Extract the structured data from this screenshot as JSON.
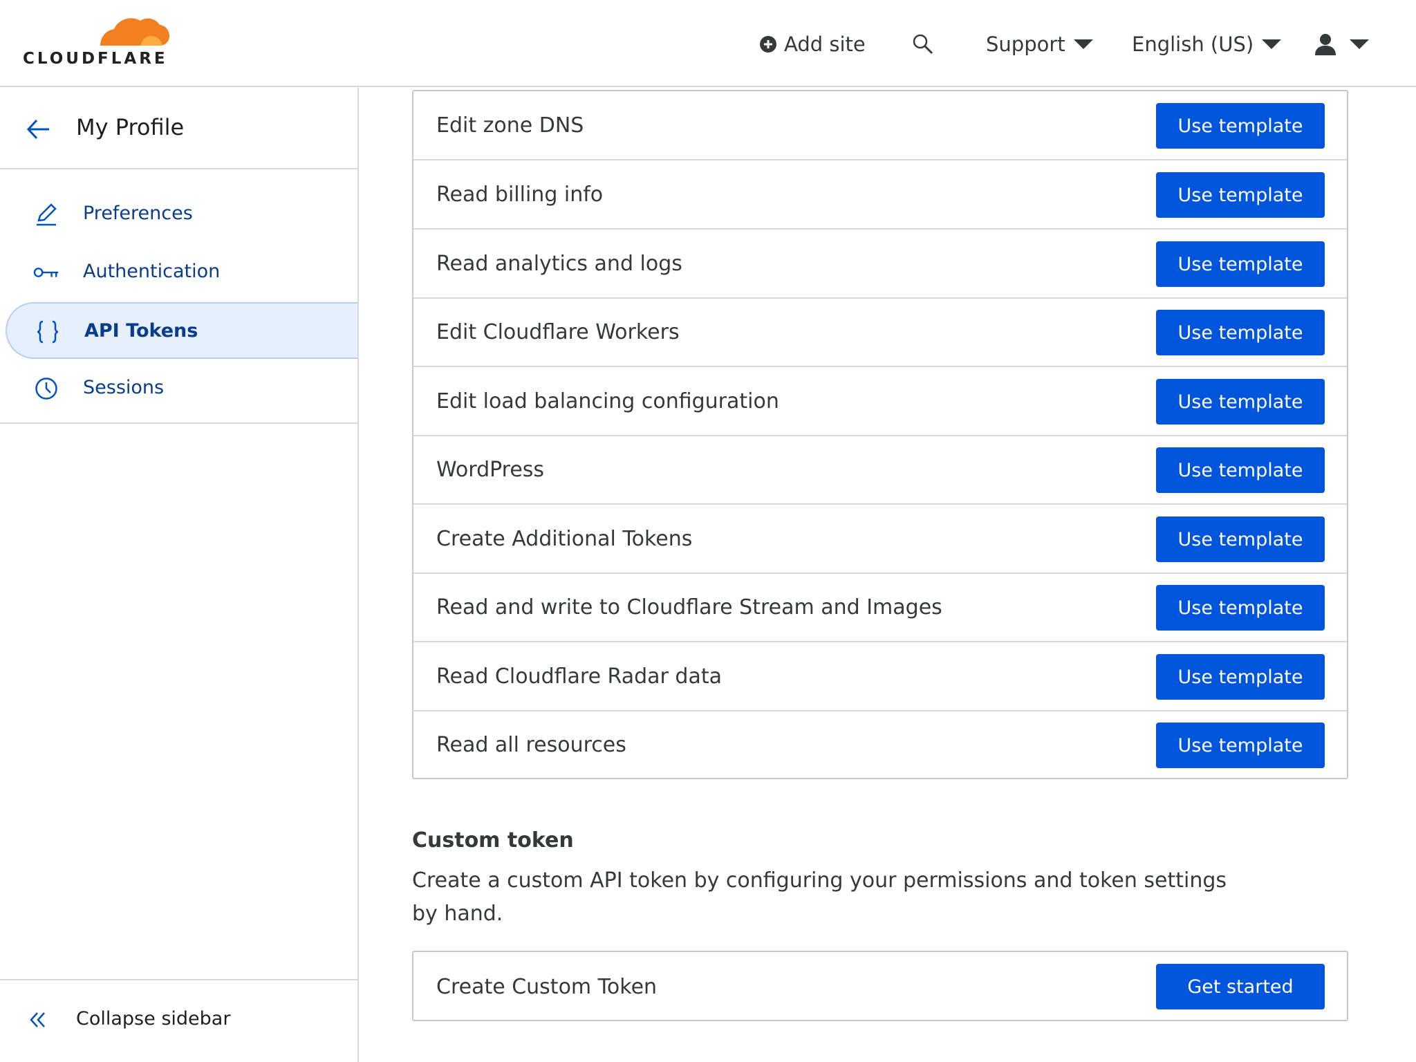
{
  "header": {
    "logo_text": "CLOUDFLARE",
    "add_site_label": "Add site",
    "support_label": "Support",
    "language_label": "English (US)",
    "icons": [
      "plus-circle-icon",
      "search-icon",
      "user-icon",
      "caret-down-icon"
    ]
  },
  "sidebar": {
    "title": "My Profile",
    "items": [
      {
        "label": "Preferences",
        "icon": "pencil-icon",
        "active": false
      },
      {
        "label": "Authentication",
        "icon": "key-icon",
        "active": false
      },
      {
        "label": "API Tokens",
        "icon": "braces-icon",
        "active": true
      },
      {
        "label": "Sessions",
        "icon": "clock-icon",
        "active": false
      }
    ],
    "collapse_label": "Collapse sidebar"
  },
  "templates": {
    "rows": [
      {
        "name": "Edit zone DNS",
        "button": "Use template"
      },
      {
        "name": "Read billing info",
        "button": "Use template"
      },
      {
        "name": "Read analytics and logs",
        "button": "Use template"
      },
      {
        "name": "Edit Cloudflare Workers",
        "button": "Use template"
      },
      {
        "name": "Edit load balancing configuration",
        "button": "Use template"
      },
      {
        "name": "WordPress",
        "button": "Use template"
      },
      {
        "name": "Create Additional Tokens",
        "button": "Use template"
      },
      {
        "name": "Read and write to Cloudflare Stream and Images",
        "button": "Use template"
      },
      {
        "name": "Read Cloudflare Radar data",
        "button": "Use template"
      },
      {
        "name": "Read all resources",
        "button": "Use template"
      }
    ]
  },
  "custom": {
    "title": "Custom token",
    "description": "Create a custom API token by configuring your permissions and token settings by hand.",
    "row_name": "Create Custom Token",
    "button": "Get started"
  },
  "colors": {
    "accent": "#0055dc",
    "nav_text": "#0a3c8c",
    "active_bg": "#e6f0fc",
    "logo_orange": "#f38020"
  }
}
